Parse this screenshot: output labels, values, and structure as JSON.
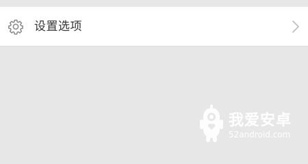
{
  "settings_item": {
    "label": "设置选项",
    "icon": "gear-icon",
    "trailing_icon": "chevron-right-icon"
  },
  "watermark": {
    "brand": "我爱安卓",
    "domain": "52android.com",
    "logo": "android-mascot-logo"
  },
  "colors": {
    "background": "#e7e7e7",
    "row_background": "#ffffff",
    "text": "#333333",
    "icon": "#888888",
    "chevron": "#bbbbbb",
    "watermark": "#ffffff"
  }
}
